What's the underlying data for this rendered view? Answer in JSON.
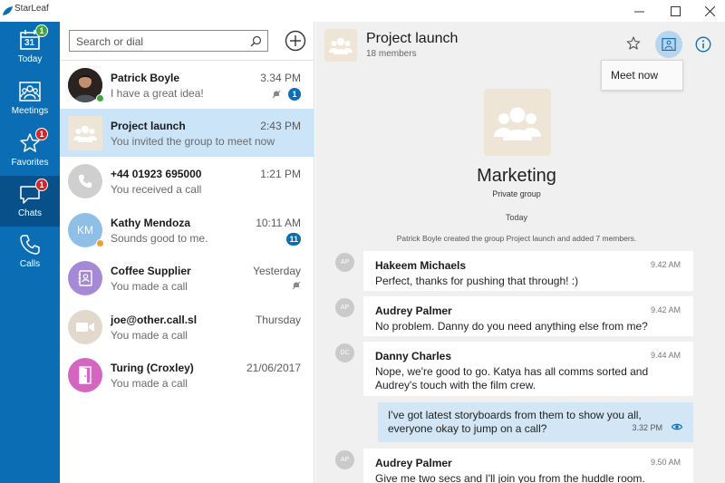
{
  "window": {
    "title": "StarLeaf",
    "minimize": "—",
    "maximize": "☐",
    "close": "✕"
  },
  "nav": {
    "items": [
      {
        "label": "Today",
        "icon": "calendar-icon",
        "calendar_day": "31",
        "badge": "1",
        "badge_color": "#3fa83b"
      },
      {
        "label": "Meetings",
        "icon": "meetings-icon"
      },
      {
        "label": "Favorites",
        "icon": "star-icon",
        "badge": "1",
        "badge_color": "#d6262b"
      },
      {
        "label": "Chats",
        "icon": "chat-icon",
        "badge": "1",
        "badge_color": "#d6262b",
        "active": true
      },
      {
        "label": "Calls",
        "icon": "phone-icon"
      }
    ]
  },
  "search": {
    "placeholder": "Search or dial"
  },
  "conversations": [
    {
      "name": "Patrick Boyle",
      "preview": "I have a great idea!",
      "time": "3.34 PM",
      "unread": "1",
      "muted": true,
      "avatar": "photo",
      "presence": "#3fa83b"
    },
    {
      "name": "Project launch",
      "preview": "You invited the group to meet now",
      "time": "2:43 PM",
      "avatar": "group",
      "selected": true
    },
    {
      "name": "+44 01923 695000",
      "preview": "You received a call",
      "time": "1:21 PM",
      "avatar": "phone"
    },
    {
      "name": "Kathy Mendoza",
      "preview": "Sounds good to me.",
      "time": "10:11 AM",
      "unread": "11",
      "avatar": "initials",
      "initials": "KM",
      "presence": "#f0a030"
    },
    {
      "name": "Coffee Supplier",
      "preview": "You made a call",
      "time": "Yesterday",
      "muted": true,
      "avatar": "contacts"
    },
    {
      "name": "joe@other.call.sl",
      "preview": "You made a call",
      "time": "Thursday",
      "avatar": "video"
    },
    {
      "name": "Turing (Croxley)",
      "preview": "You made a call",
      "time": "21/06/2017",
      "avatar": "door"
    }
  ],
  "chat": {
    "title": "Project launch",
    "members": "18 members",
    "meet_now": "Meet now",
    "group_name": "Marketing",
    "group_type": "Private group",
    "day": "Today",
    "system_message": "Patrick Boyle created the group Project launch and added 7 members.",
    "messages": [
      {
        "initials": "AP",
        "name": "Hakeem Michaels",
        "time": "9.42 AM",
        "text": "Perfect, thanks for pushing that through! :)"
      },
      {
        "initials": "AP",
        "name": "Audrey Palmer",
        "time": "9.42 AM",
        "text": "No problem. Danny do you need anything else from me?"
      },
      {
        "initials": "DC",
        "name": "Danny Charles",
        "time": "9.44 AM",
        "text": "Nope, we're good to go. Katya has all comms sorted and Audrey's touch with the film crew."
      },
      {
        "mine": true,
        "time": "3.32 PM",
        "text": "I've got latest storyboards from them to show you all, everyone okay to jump on a call?"
      },
      {
        "initials": "AP",
        "name": "Audrey Palmer",
        "time": "9.50 AM",
        "text": "Give me two secs and I'll join you from the huddle room."
      }
    ]
  },
  "colors": {
    "nav_bg": "#0b6db3",
    "nav_active": "#07508a",
    "selected_row": "#cce4f7",
    "chat_bg": "#f0f0f0",
    "my_bubble": "#d3e6f5"
  }
}
